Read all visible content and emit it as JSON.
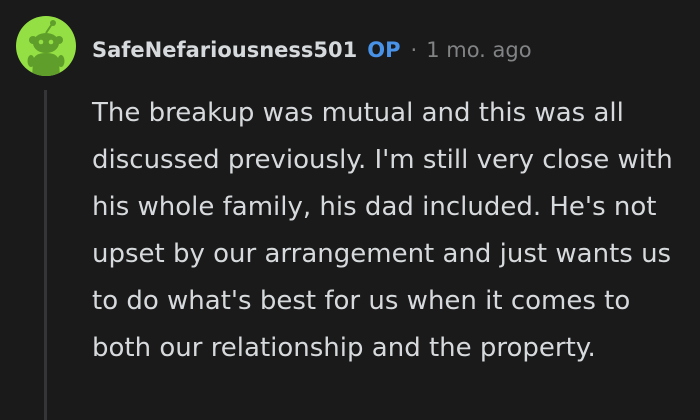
{
  "comment": {
    "author": {
      "username": "SafeNefariousness501",
      "badge": "OP",
      "avatar_icon": "snoo-avatar-icon",
      "avatar_bg": "#94e044"
    },
    "separator": "·",
    "timestamp": "1 mo. ago",
    "body": "The breakup was mutual and this was all discussed previously. I'm still very close with his whole family, his dad included. He's not upset by our arrangement and just wants us to do what's best for us when it comes to both our relationship and the property."
  },
  "colors": {
    "background": "#1a1a1b",
    "text": "#d7dadc",
    "meta": "#818384",
    "op_badge": "#4892e8",
    "thread_line": "#343536"
  }
}
